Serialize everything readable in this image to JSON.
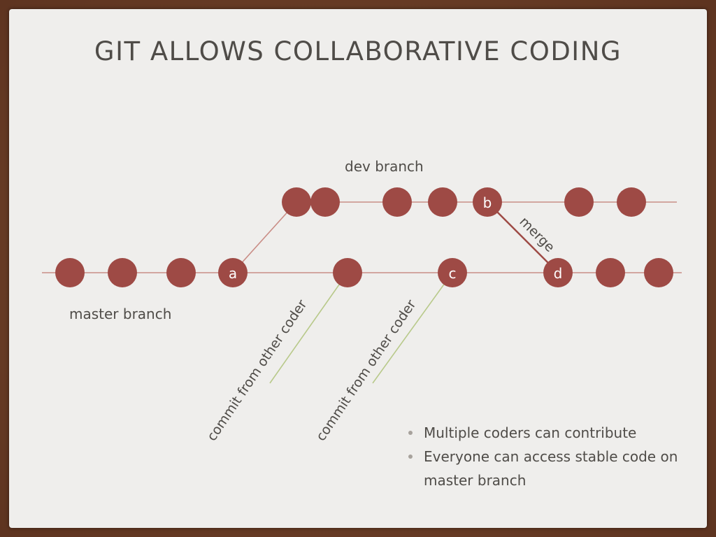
{
  "slide": {
    "title": "GIT ALLOWS COLLABORATIVE CODING",
    "bullets": [
      "Multiple coders can contribute",
      "Everyone can access stable code on master branch"
    ]
  },
  "diagram": {
    "labels": {
      "dev_branch": "dev branch",
      "master_branch": "master branch",
      "merge": "merge",
      "commit_1": "commit from other coder",
      "commit_2": "commit from other coder"
    },
    "node_labels": {
      "a": "a",
      "b": "b",
      "c": "c",
      "d": "d"
    },
    "colors": {
      "node": "#9e4a45",
      "branch_line": "#c98d86",
      "annotation_line": "#b8c98a",
      "text": "#4f4c48",
      "node_text": "#ffffff"
    }
  }
}
